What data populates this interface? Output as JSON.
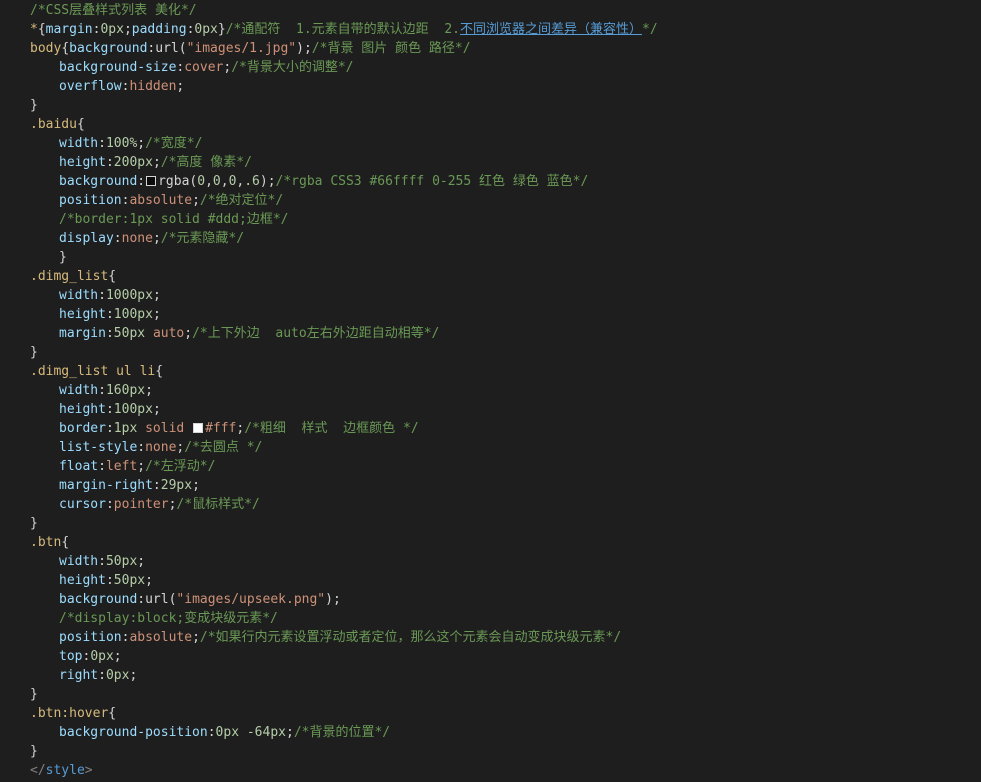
{
  "swatch_colors": {
    "rgba_black": "rgba(0,0,0,.6)",
    "white": "#ffffff"
  },
  "lines": [
    {
      "indent": 0,
      "tokens": [
        {
          "t": "/*CSS层叠样式列表 美化*/",
          "c": "cmt"
        }
      ]
    },
    {
      "indent": 0,
      "tokens": [
        {
          "t": "*",
          "c": "sel"
        },
        {
          "t": "{",
          "c": "punc"
        },
        {
          "t": "margin",
          "c": "prop"
        },
        {
          "t": ":",
          "c": "punc"
        },
        {
          "t": "0px",
          "c": "num"
        },
        {
          "t": ";",
          "c": "punc"
        },
        {
          "t": "padding",
          "c": "prop"
        },
        {
          "t": ":",
          "c": "punc"
        },
        {
          "t": "0px",
          "c": "num"
        },
        {
          "t": "}",
          "c": "punc"
        },
        {
          "t": "/*通配符  1.元素自带的默认边距  2.",
          "c": "cmt"
        },
        {
          "t": "不同浏览器之间差异（兼容性）",
          "c": "link"
        },
        {
          "t": "*/",
          "c": "cmt"
        }
      ]
    },
    {
      "indent": 0,
      "tokens": [
        {
          "t": "body",
          "c": "sel"
        },
        {
          "t": "{",
          "c": "punc"
        },
        {
          "t": "background",
          "c": "prop"
        },
        {
          "t": ":",
          "c": "punc"
        },
        {
          "t": "url(",
          "c": "punc"
        },
        {
          "t": "\"images/1.jpg\"",
          "c": "val"
        },
        {
          "t": ");",
          "c": "punc"
        },
        {
          "t": "/*背景 图片 颜色 路径*/",
          "c": "cmt"
        }
      ]
    },
    {
      "indent": 1,
      "tokens": [
        {
          "t": "background-size",
          "c": "prop"
        },
        {
          "t": ":",
          "c": "punc"
        },
        {
          "t": "cover",
          "c": "val"
        },
        {
          "t": ";",
          "c": "punc"
        },
        {
          "t": "/*背景大小的调整*/",
          "c": "cmt"
        }
      ]
    },
    {
      "indent": 1,
      "tokens": [
        {
          "t": "overflow",
          "c": "prop"
        },
        {
          "t": ":",
          "c": "punc"
        },
        {
          "t": "hidden",
          "c": "val"
        },
        {
          "t": ";",
          "c": "punc"
        }
      ]
    },
    {
      "indent": 0,
      "tokens": [
        {
          "t": "}",
          "c": "punc"
        }
      ]
    },
    {
      "indent": 0,
      "tokens": [
        {
          "t": ".baidu",
          "c": "sel"
        },
        {
          "t": "{",
          "c": "punc"
        }
      ]
    },
    {
      "indent": 1,
      "tokens": [
        {
          "t": "width",
          "c": "prop"
        },
        {
          "t": ":",
          "c": "punc"
        },
        {
          "t": "100%",
          "c": "num"
        },
        {
          "t": ";",
          "c": "punc"
        },
        {
          "t": "/*宽度*/",
          "c": "cmt"
        }
      ]
    },
    {
      "indent": 1,
      "tokens": [
        {
          "t": "height",
          "c": "prop"
        },
        {
          "t": ":",
          "c": "punc"
        },
        {
          "t": "200px",
          "c": "num"
        },
        {
          "t": ";",
          "c": "punc"
        },
        {
          "t": "/*高度 像素*/",
          "c": "cmt"
        }
      ]
    },
    {
      "indent": 1,
      "tokens": [
        {
          "t": "background",
          "c": "prop"
        },
        {
          "t": ":",
          "c": "punc"
        },
        {
          "swatch": "rgba_black"
        },
        {
          "t": "rgba(",
          "c": "punc"
        },
        {
          "t": "0",
          "c": "num"
        },
        {
          "t": ",",
          "c": "punc"
        },
        {
          "t": "0",
          "c": "num"
        },
        {
          "t": ",",
          "c": "punc"
        },
        {
          "t": "0",
          "c": "num"
        },
        {
          "t": ",",
          "c": "punc"
        },
        {
          "t": ".6",
          "c": "num"
        },
        {
          "t": ");",
          "c": "punc"
        },
        {
          "t": "/*rgba CSS3 #66ffff 0-255 红色 绿色 蓝色*/",
          "c": "cmt"
        }
      ]
    },
    {
      "indent": 1,
      "tokens": [
        {
          "t": "position",
          "c": "prop"
        },
        {
          "t": ":",
          "c": "punc"
        },
        {
          "t": "absolute",
          "c": "val"
        },
        {
          "t": ";",
          "c": "punc"
        },
        {
          "t": "/*绝对定位*/",
          "c": "cmt"
        }
      ]
    },
    {
      "indent": 1,
      "tokens": [
        {
          "t": "/*border:1px solid #ddd;边框*/",
          "c": "cmt"
        }
      ]
    },
    {
      "indent": 1,
      "tokens": [
        {
          "t": "display",
          "c": "prop"
        },
        {
          "t": ":",
          "c": "punc"
        },
        {
          "t": "none",
          "c": "val"
        },
        {
          "t": ";",
          "c": "punc"
        },
        {
          "t": "/*元素隐藏*/",
          "c": "cmt"
        }
      ]
    },
    {
      "indent": 1,
      "tokens": [
        {
          "t": "}",
          "c": "punc"
        }
      ]
    },
    {
      "indent": 0,
      "tokens": [
        {
          "t": ".dimg_list",
          "c": "sel"
        },
        {
          "t": "{",
          "c": "punc"
        }
      ]
    },
    {
      "indent": 1,
      "tokens": [
        {
          "t": "width",
          "c": "prop"
        },
        {
          "t": ":",
          "c": "punc"
        },
        {
          "t": "1000px",
          "c": "num"
        },
        {
          "t": ";",
          "c": "punc"
        }
      ]
    },
    {
      "indent": 1,
      "tokens": [
        {
          "t": "height",
          "c": "prop"
        },
        {
          "t": ":",
          "c": "punc"
        },
        {
          "t": "100px",
          "c": "num"
        },
        {
          "t": ";",
          "c": "punc"
        }
      ]
    },
    {
      "indent": 1,
      "tokens": [
        {
          "t": "margin",
          "c": "prop"
        },
        {
          "t": ":",
          "c": "punc"
        },
        {
          "t": "50px",
          "c": "num"
        },
        {
          "t": " ",
          "c": "punc"
        },
        {
          "t": "auto",
          "c": "val"
        },
        {
          "t": ";",
          "c": "punc"
        },
        {
          "t": "/*上下外边  auto左右外边距自动相等*/",
          "c": "cmt"
        }
      ]
    },
    {
      "indent": 0,
      "tokens": [
        {
          "t": "}",
          "c": "punc"
        }
      ]
    },
    {
      "indent": 0,
      "tokens": [
        {
          "t": ".dimg_list ul li",
          "c": "sel"
        },
        {
          "t": "{",
          "c": "punc"
        }
      ]
    },
    {
      "indent": 1,
      "tokens": [
        {
          "t": "width",
          "c": "prop"
        },
        {
          "t": ":",
          "c": "punc"
        },
        {
          "t": "160px",
          "c": "num"
        },
        {
          "t": ";",
          "c": "punc"
        }
      ]
    },
    {
      "indent": 1,
      "tokens": [
        {
          "t": "height",
          "c": "prop"
        },
        {
          "t": ":",
          "c": "punc"
        },
        {
          "t": "100px",
          "c": "num"
        },
        {
          "t": ";",
          "c": "punc"
        }
      ]
    },
    {
      "indent": 1,
      "tokens": [
        {
          "t": "border",
          "c": "prop"
        },
        {
          "t": ":",
          "c": "punc"
        },
        {
          "t": "1px",
          "c": "num"
        },
        {
          "t": " ",
          "c": "punc"
        },
        {
          "t": "solid",
          "c": "val"
        },
        {
          "t": " ",
          "c": "punc"
        },
        {
          "swatch": "white"
        },
        {
          "t": "#fff",
          "c": "val"
        },
        {
          "t": ";",
          "c": "punc"
        },
        {
          "t": "/*粗细  样式  边框颜色 */",
          "c": "cmt"
        }
      ]
    },
    {
      "indent": 1,
      "tokens": [
        {
          "t": "list-style",
          "c": "prop"
        },
        {
          "t": ":",
          "c": "punc"
        },
        {
          "t": "none",
          "c": "val"
        },
        {
          "t": ";",
          "c": "punc"
        },
        {
          "t": "/*去圆点 */",
          "c": "cmt"
        }
      ]
    },
    {
      "indent": 1,
      "tokens": [
        {
          "t": "float",
          "c": "prop"
        },
        {
          "t": ":",
          "c": "punc"
        },
        {
          "t": "left",
          "c": "val"
        },
        {
          "t": ";",
          "c": "punc"
        },
        {
          "t": "/*左浮动*/",
          "c": "cmt"
        }
      ]
    },
    {
      "indent": 1,
      "tokens": [
        {
          "t": "margin-right",
          "c": "prop"
        },
        {
          "t": ":",
          "c": "punc"
        },
        {
          "t": "29px",
          "c": "num"
        },
        {
          "t": ";",
          "c": "punc"
        }
      ]
    },
    {
      "indent": 1,
      "tokens": [
        {
          "t": "cursor",
          "c": "prop"
        },
        {
          "t": ":",
          "c": "punc"
        },
        {
          "t": "pointer",
          "c": "val"
        },
        {
          "t": ";",
          "c": "punc"
        },
        {
          "t": "/*鼠标样式*/",
          "c": "cmt"
        }
      ]
    },
    {
      "indent": 0,
      "tokens": [
        {
          "t": "}",
          "c": "punc"
        }
      ]
    },
    {
      "indent": 0,
      "tokens": [
        {
          "t": ".btn",
          "c": "sel"
        },
        {
          "t": "{",
          "c": "punc"
        }
      ]
    },
    {
      "indent": 1,
      "tokens": [
        {
          "t": "width",
          "c": "prop"
        },
        {
          "t": ":",
          "c": "punc"
        },
        {
          "t": "50px",
          "c": "num"
        },
        {
          "t": ";",
          "c": "punc"
        }
      ]
    },
    {
      "indent": 1,
      "tokens": [
        {
          "t": "height",
          "c": "prop"
        },
        {
          "t": ":",
          "c": "punc"
        },
        {
          "t": "50px",
          "c": "num"
        },
        {
          "t": ";",
          "c": "punc"
        }
      ]
    },
    {
      "indent": 1,
      "tokens": [
        {
          "t": "background",
          "c": "prop"
        },
        {
          "t": ":",
          "c": "punc"
        },
        {
          "t": "url(",
          "c": "punc"
        },
        {
          "t": "\"images/upseek.png\"",
          "c": "val"
        },
        {
          "t": ");",
          "c": "punc"
        }
      ]
    },
    {
      "indent": 1,
      "tokens": [
        {
          "t": "/*display:block;变成块级元素*/",
          "c": "cmt"
        }
      ]
    },
    {
      "indent": 1,
      "tokens": [
        {
          "t": "position",
          "c": "prop"
        },
        {
          "t": ":",
          "c": "punc"
        },
        {
          "t": "absolute",
          "c": "val"
        },
        {
          "t": ";",
          "c": "punc"
        },
        {
          "t": "/*如果行内元素设置浮动或者定位，那么这个元素会自动变成块级元素*/",
          "c": "cmt"
        }
      ]
    },
    {
      "indent": 1,
      "tokens": [
        {
          "t": "top",
          "c": "prop"
        },
        {
          "t": ":",
          "c": "punc"
        },
        {
          "t": "0px",
          "c": "num"
        },
        {
          "t": ";",
          "c": "punc"
        }
      ]
    },
    {
      "indent": 1,
      "tokens": [
        {
          "t": "right",
          "c": "prop"
        },
        {
          "t": ":",
          "c": "punc"
        },
        {
          "t": "0px",
          "c": "num"
        },
        {
          "t": ";",
          "c": "punc"
        }
      ]
    },
    {
      "indent": 0,
      "tokens": [
        {
          "t": "}",
          "c": "punc"
        }
      ]
    },
    {
      "indent": 0,
      "tokens": [
        {
          "t": ".btn:hover",
          "c": "sel"
        },
        {
          "t": "{",
          "c": "punc"
        }
      ]
    },
    {
      "indent": 1,
      "tokens": [
        {
          "t": "background-position",
          "c": "prop"
        },
        {
          "t": ":",
          "c": "punc"
        },
        {
          "t": "0px",
          "c": "num"
        },
        {
          "t": " ",
          "c": "punc"
        },
        {
          "t": "-64px",
          "c": "num"
        },
        {
          "t": ";",
          "c": "punc"
        },
        {
          "t": "/*背景的位置*/",
          "c": "cmt"
        }
      ]
    },
    {
      "indent": 0,
      "tokens": [
        {
          "t": "}",
          "c": "punc"
        }
      ]
    },
    {
      "indent": 0,
      "tokens": [
        {
          "t": "</",
          "c": "tag"
        },
        {
          "t": "style",
          "c": "tagname"
        },
        {
          "t": ">",
          "c": "tag"
        }
      ]
    }
  ]
}
